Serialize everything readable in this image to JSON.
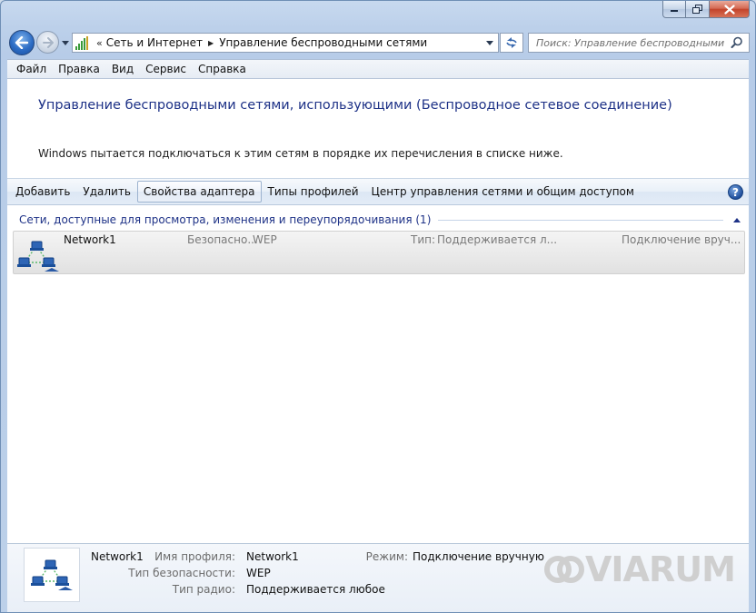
{
  "window": {
    "controls": {
      "minimize": "minimize",
      "maximize": "maximize",
      "close": "close"
    }
  },
  "nav": {
    "breadcrumb_prefix": "«",
    "breadcrumbs": [
      "Сеть и Интернет",
      "Управление беспроводными сетями"
    ],
    "search_placeholder": "Поиск: Управление беспроводными ..."
  },
  "menu": [
    "Файл",
    "Правка",
    "Вид",
    "Сервис",
    "Справка"
  ],
  "page": {
    "title": "Управление беспроводными сетями, использующими (Беспроводное сетевое соединение)",
    "description": "Windows пытается подключаться к этим сетям в порядке их перечисления в списке ниже."
  },
  "toolbar": {
    "add": "Добавить",
    "remove": "Удалить",
    "adapter_props": "Свойства адаптера",
    "profile_types": "Типы профилей",
    "network_center": "Центр управления сетями и общим доступом",
    "help": "?"
  },
  "group": {
    "title": "Сети, доступные для просмотра, изменения и переупорядочивания (1)"
  },
  "networks": [
    {
      "name": "Network1",
      "security_label": "Безопасно...",
      "security_value": "WEP",
      "type_label": "Тип:",
      "type_value": "Поддерживается л...",
      "mode": "Подключение вруч..."
    }
  ],
  "details": {
    "name": "Network1",
    "profile_label": "Имя профиля:",
    "profile_value": "Network1",
    "security_label": "Тип безопасности:",
    "security_value": "WEP",
    "radio_label": "Тип радио:",
    "radio_value": "Поддерживается любое",
    "mode_label": "Режим:",
    "mode_value": "Подключение вручную"
  },
  "watermark": "VIARUM",
  "colors": {
    "title_blue": "#1e3287",
    "link_blue": "#1e3287"
  }
}
